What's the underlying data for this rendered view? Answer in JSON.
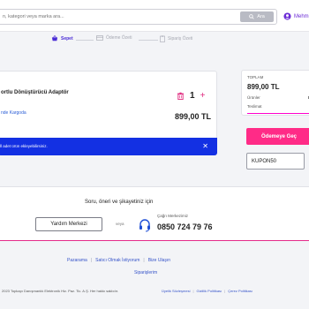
{
  "header": {
    "search_placeholder": "n, kategori veya marka ara...",
    "search_button": "Ara",
    "user_label": "Mehm"
  },
  "stepper": {
    "steps": [
      {
        "label": "Sepet",
        "state": "active"
      },
      {
        "label": "Ödeme Özeti",
        "state": "inactive"
      },
      {
        "label": "Sipariş Özeti",
        "state": "inactive"
      }
    ]
  },
  "cart": {
    "product_name": "ortlu Dönüştürücü Adaptör",
    "delivery_text": "nde Kargoda",
    "quantity": "1",
    "price": "899,00 TL",
    "banner_text": "ll adet ürün ekleyebilirsiniz."
  },
  "summary": {
    "total_label": "TOPLAM",
    "total_value": "899,00 TL",
    "rows": [
      {
        "label": "Ürünler",
        "value": "89"
      },
      {
        "label": "Teslimat",
        "value": ""
      }
    ],
    "checkout_button": "Ödemeye Geç",
    "coupon_value": "KUPON50"
  },
  "feedback": {
    "title": "Soru, öneri ve şikayetiniz için",
    "help_button": "Yardım Merkezi",
    "or_text": "veya",
    "call_label": "Çağrı Merkezimiz",
    "call_number": "0850 724 79 76"
  },
  "footer": {
    "links": [
      "Pazarama",
      "Satıcı Olmak İstiyorum",
      "Bize Ulaşın"
    ],
    "orders_link": "Siparişlerim",
    "copyright": "2023 Topkapı Danışmanlık Elektronik Hiz. Paz. Tic. A.Ş. Her hakkı saklıdır.",
    "legal_links": [
      "Üyelik Sözleşmesi",
      "Gizlilik Politikası",
      "Çerez Politikası"
    ]
  },
  "colors": {
    "accent_purple": "#4b2dd6",
    "pink": "#ff2b87",
    "banner_blue": "#1330e3"
  }
}
